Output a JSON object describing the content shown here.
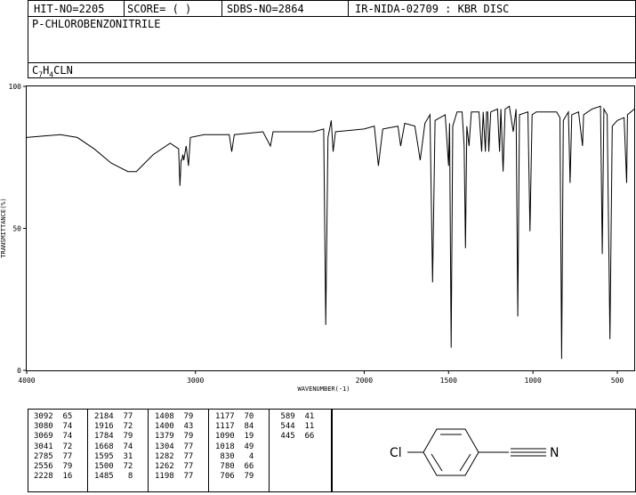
{
  "header": {
    "hit_no": "HIT-NO=2205",
    "score": "SCORE=  (   )",
    "sdbs_no": "SDBS-NO=2864",
    "ir_code": "IR-NIDA-02709 : KBR DISC"
  },
  "compound": {
    "name": "P-CHLOROBENZONITRILE",
    "formula_parts": [
      "C",
      "7",
      "H",
      "4",
      "CLN"
    ]
  },
  "structure": {
    "left_label": "Cl",
    "right_label": "N"
  },
  "chart_data": {
    "type": "line",
    "xlabel": "WAVENUMBER(-1)",
    "ylabel": "TRANSMITTANCE(%)",
    "xlim": [
      4000,
      400
    ],
    "ylim": [
      0,
      100
    ],
    "x_ticks": [
      4000,
      3000,
      2000,
      1500,
      1000,
      500
    ],
    "y_ticks": [
      100,
      50,
      0
    ],
    "grid": false,
    "spectrum": [
      [
        4000,
        82
      ],
      [
        3900,
        82.5
      ],
      [
        3800,
        83
      ],
      [
        3700,
        82
      ],
      [
        3600,
        78
      ],
      [
        3500,
        73
      ],
      [
        3400,
        70
      ],
      [
        3350,
        70
      ],
      [
        3300,
        73
      ],
      [
        3250,
        76
      ],
      [
        3150,
        80
      ],
      [
        3100,
        78
      ],
      [
        3092,
        65
      ],
      [
        3085,
        74
      ],
      [
        3080,
        74
      ],
      [
        3075,
        76
      ],
      [
        3069,
        74
      ],
      [
        3055,
        79
      ],
      [
        3041,
        72
      ],
      [
        3030,
        82
      ],
      [
        2950,
        83
      ],
      [
        2800,
        83
      ],
      [
        2785,
        77
      ],
      [
        2770,
        83
      ],
      [
        2600,
        84
      ],
      [
        2556,
        79
      ],
      [
        2540,
        84
      ],
      [
        2300,
        84
      ],
      [
        2240,
        85
      ],
      [
        2228,
        16
      ],
      [
        2215,
        82
      ],
      [
        2195,
        88
      ],
      [
        2184,
        77
      ],
      [
        2170,
        84
      ],
      [
        2000,
        85
      ],
      [
        1940,
        86
      ],
      [
        1916,
        72
      ],
      [
        1890,
        85
      ],
      [
        1800,
        86
      ],
      [
        1784,
        79
      ],
      [
        1760,
        87
      ],
      [
        1700,
        86
      ],
      [
        1668,
        74
      ],
      [
        1640,
        87
      ],
      [
        1610,
        90
      ],
      [
        1595,
        31
      ],
      [
        1580,
        88
      ],
      [
        1520,
        90
      ],
      [
        1500,
        72
      ],
      [
        1494,
        87
      ],
      [
        1485,
        8
      ],
      [
        1475,
        86
      ],
      [
        1450,
        91
      ],
      [
        1420,
        91
      ],
      [
        1408,
        79
      ],
      [
        1400,
        43
      ],
      [
        1392,
        86
      ],
      [
        1379,
        79
      ],
      [
        1365,
        91
      ],
      [
        1320,
        91
      ],
      [
        1304,
        77
      ],
      [
        1295,
        91
      ],
      [
        1282,
        77
      ],
      [
        1275,
        91
      ],
      [
        1268,
        91
      ],
      [
        1262,
        77
      ],
      [
        1250,
        91
      ],
      [
        1210,
        92
      ],
      [
        1198,
        77
      ],
      [
        1190,
        92
      ],
      [
        1177,
        70
      ],
      [
        1165,
        92
      ],
      [
        1140,
        93
      ],
      [
        1117,
        84
      ],
      [
        1100,
        92
      ],
      [
        1090,
        19
      ],
      [
        1080,
        90
      ],
      [
        1030,
        91
      ],
      [
        1018,
        49
      ],
      [
        1005,
        90
      ],
      [
        980,
        91
      ],
      [
        900,
        91
      ],
      [
        860,
        91
      ],
      [
        840,
        89
      ],
      [
        830,
        4
      ],
      [
        820,
        88
      ],
      [
        790,
        91
      ],
      [
        780,
        66
      ],
      [
        770,
        90
      ],
      [
        730,
        91
      ],
      [
        706,
        79
      ],
      [
        700,
        90
      ],
      [
        650,
        92
      ],
      [
        600,
        93
      ],
      [
        589,
        41
      ],
      [
        580,
        92
      ],
      [
        560,
        90
      ],
      [
        544,
        11
      ],
      [
        530,
        86
      ],
      [
        500,
        88
      ],
      [
        460,
        89
      ],
      [
        445,
        66
      ],
      [
        440,
        90
      ],
      [
        420,
        91
      ],
      [
        400,
        92
      ]
    ],
    "peaks": [
      [
        3092,
        65
      ],
      [
        3080,
        74
      ],
      [
        3069,
        74
      ],
      [
        3041,
        72
      ],
      [
        2785,
        77
      ],
      [
        2556,
        79
      ],
      [
        2228,
        16
      ],
      [
        2184,
        77
      ],
      [
        1916,
        72
      ],
      [
        1784,
        79
      ],
      [
        1668,
        74
      ],
      [
        1595,
        31
      ],
      [
        1500,
        72
      ],
      [
        1485,
        8
      ],
      [
        1408,
        79
      ],
      [
        1400,
        43
      ],
      [
        1379,
        79
      ],
      [
        1304,
        77
      ],
      [
        1282,
        77
      ],
      [
        1262,
        77
      ],
      [
        1198,
        77
      ],
      [
        1177,
        70
      ],
      [
        1117,
        84
      ],
      [
        1090,
        19
      ],
      [
        1018,
        49
      ],
      [
        830,
        4
      ],
      [
        780,
        66
      ],
      [
        706,
        79
      ],
      [
        589,
        41
      ],
      [
        544,
        11
      ],
      [
        445,
        66
      ]
    ]
  }
}
